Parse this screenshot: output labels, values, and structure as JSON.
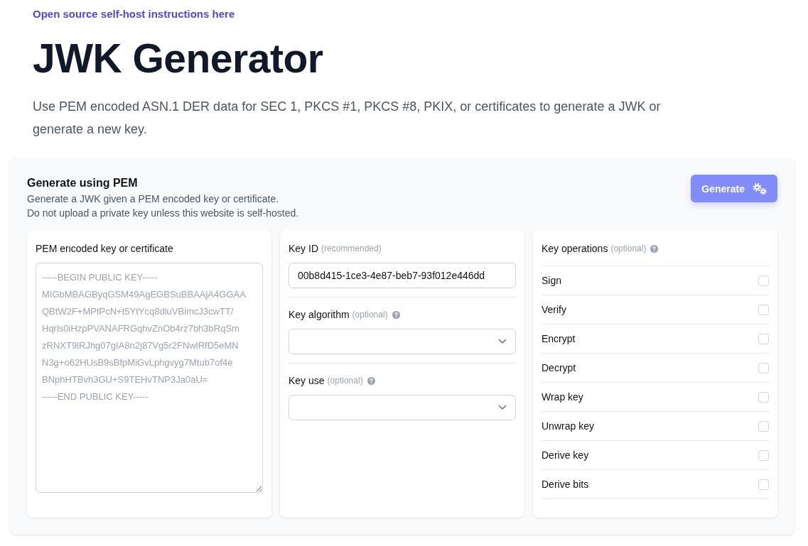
{
  "header": {
    "link": "Open source self-host instructions here",
    "title": "JWK Generator",
    "description": "Use PEM encoded ASN.1 DER data for SEC 1, PKCS #1, PKCS #8, PKIX, or certificates to generate a JWK or generate a new key."
  },
  "panel": {
    "title": "Generate using PEM",
    "notes": [
      "Generate a JWK given a PEM encoded key or certificate.",
      "Do not upload a private key unless this website is self-hosted."
    ],
    "button": "Generate"
  },
  "pem_card": {
    "label": "PEM encoded key or certificate",
    "placeholder": "-----BEGIN PUBLIC KEY-----\nMIGbMBAGByqGSM49AgEGBSuBBAAjA4GGAA\nQBtW2F+MPtPcN+t5YtYcq8dluVBimcJ3cwTT/\nHqrls0iHzpPVANAFRGqhvZnOb4rz7bh3bRqSm\nzRNXT9lRJhg07gIA8n2j87Vg5r2FNwlRfD5eMN\nN3g+o62HUsB9sBfpMiGvLphgvyg7Mtub7of4e\nBNphHTBvh3GU+S9TEHvTNP3Ja0aU=\n-----END PUBLIC KEY-----"
  },
  "fields": [
    {
      "kind": "text",
      "label": "Key ID",
      "hint": "(recommended)",
      "help": false,
      "value": "00b8d415-1ce3-4e87-beb7-93f012e446dd"
    },
    {
      "kind": "select",
      "label": "Key algorithm",
      "hint": "(optional)",
      "help": true
    },
    {
      "kind": "select",
      "label": "Key use",
      "hint": "(optional)",
      "help": true
    }
  ],
  "operations": {
    "label": "Key operations",
    "hint": "(optional)",
    "help": true,
    "items": [
      {
        "label": "Sign",
        "checked": false
      },
      {
        "label": "Verify",
        "checked": false
      },
      {
        "label": "Encrypt",
        "checked": false
      },
      {
        "label": "Decrypt",
        "checked": false
      },
      {
        "label": "Wrap key",
        "checked": false
      },
      {
        "label": "Unwrap key",
        "checked": false
      },
      {
        "label": "Derive key",
        "checked": false
      },
      {
        "label": "Derive bits",
        "checked": false
      }
    ]
  }
}
